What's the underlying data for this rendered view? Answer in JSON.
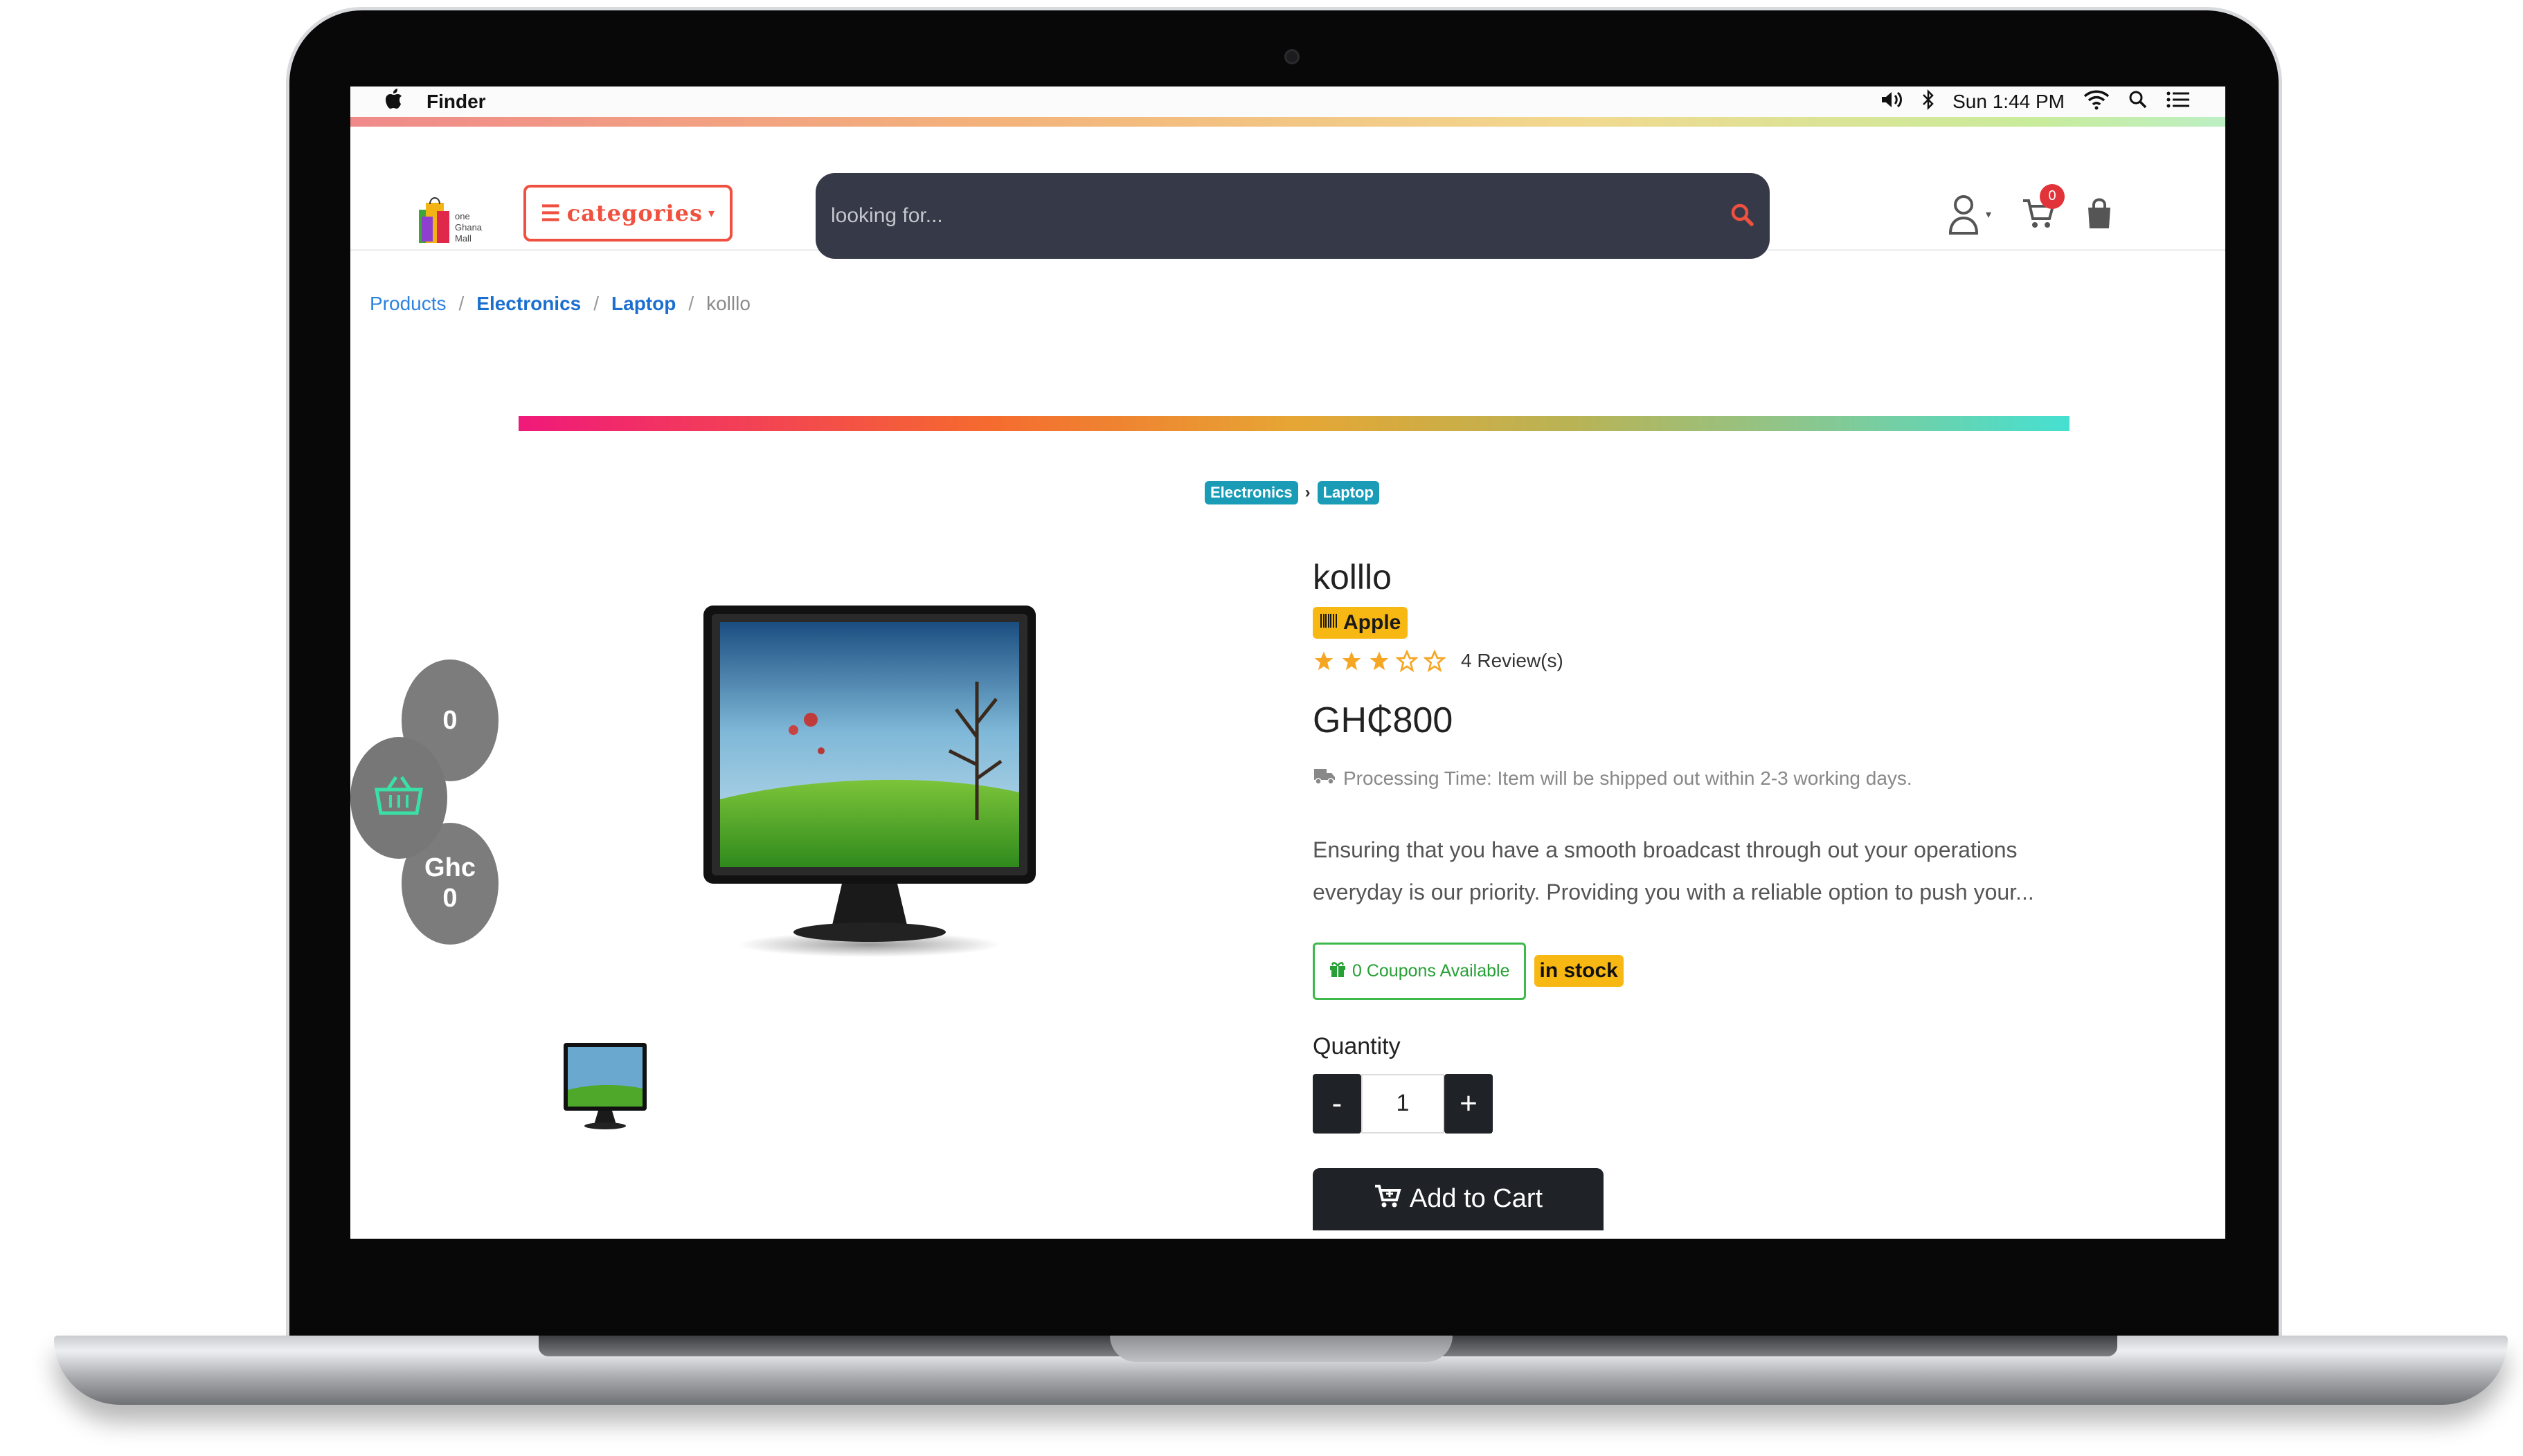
{
  "menubar": {
    "app_name": "Finder",
    "clock": "Sun 1:44 PM"
  },
  "header": {
    "logo_text": [
      "one",
      "Ghana",
      "Mall"
    ],
    "categories_label": "categories",
    "search_placeholder": "looking for...",
    "cart_count": "0"
  },
  "breadcrumb": {
    "items": [
      "Products",
      "Electronics",
      "Laptop"
    ],
    "current": "kolllo"
  },
  "category_tags": [
    "Electronics",
    "Laptop"
  ],
  "floating_cart": {
    "count": "0",
    "currency": "Ghc",
    "total": "0"
  },
  "product": {
    "title": "kolllo",
    "brand": "Apple",
    "rating": 3,
    "rating_max": 5,
    "reviews": "4 Review(s)",
    "price": "GH₵800",
    "processing": "Processing Time: Item will be shipped out within 2-3 working days.",
    "description_line1": "Ensuring that you have a smooth broadcast through out your operations",
    "description_line2": "everyday is our priority. Providing you with a reliable option to push your...",
    "coupons": "0 Coupons Available",
    "stock": "in stock",
    "quantity_label": "Quantity",
    "quantity": "1",
    "minus": "-",
    "plus": "+",
    "add_to_cart": "Add to Cart"
  },
  "colors": {
    "accent_red": "#f0503f",
    "search_bg": "#363a48",
    "tag_teal": "#1a9cb7",
    "badge_yellow": "#f7b813",
    "coupon_green": "#3db84b",
    "dark_button": "#1f2227",
    "link_blue": "#2b82e0",
    "star": "#f5a623"
  }
}
